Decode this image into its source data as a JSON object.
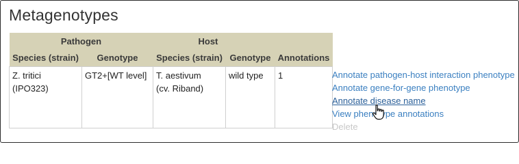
{
  "section": {
    "title": "Metagenotypes"
  },
  "table": {
    "group_headers": {
      "pathogen": "Pathogen",
      "host": "Host"
    },
    "columns": {
      "pathogen_species": "Species (strain)",
      "pathogen_genotype": "Genotype",
      "host_species": "Species (strain)",
      "host_genotype": "Genotype",
      "annotations": "Annotations"
    },
    "rows": [
      {
        "pathogen_species": "Z. tritici",
        "pathogen_strain": "(IPO323)",
        "pathogen_genotype": "GT2+[WT level]",
        "host_species": "T. aestivum",
        "host_strain": "(cv. Riband)",
        "host_genotype": "wild type",
        "annotations": "1"
      }
    ]
  },
  "actions": {
    "annotate_phi": "Annotate pathogen-host interaction phenotype",
    "annotate_gfg": "Annotate gene-for-gene phenotype",
    "annotate_disease": "Annotate disease name",
    "view_phenotype": "View phenotype annotations",
    "delete": "Delete"
  },
  "cursor": {
    "icon": "hand-pointer-icon"
  }
}
